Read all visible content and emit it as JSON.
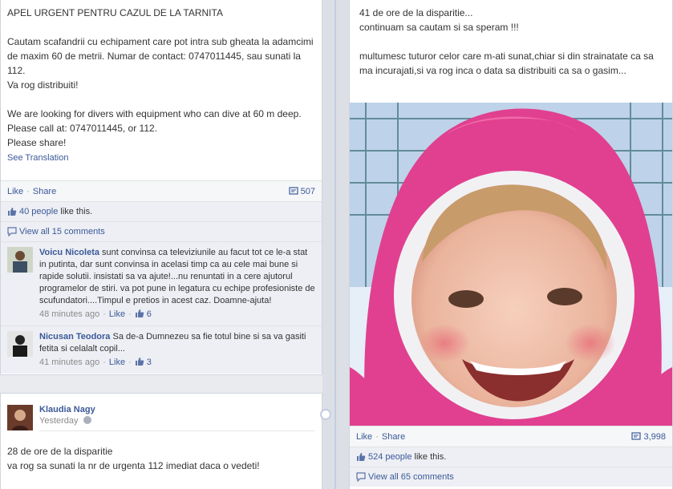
{
  "left_post": {
    "title": "APEL URGENT PENTRU CAZUL DE LA TARNITA",
    "body_ro": "Cautam scafandrii cu echipament care pot intra sub gheata la adamcimi de maxim 60 de metrii. Numar de contact: 0747011445, sau sunati la 112.\nVa rog distribuiti!",
    "body_en": "We are looking for divers with equipment who can dive at 60 m deep. Please call at: 0747011445, or 112.\nPlease share!",
    "see_translation": "See Translation",
    "like_label": "Like",
    "share_label": "Share",
    "share_count": "507",
    "likes_people": "40 people",
    "likes_suffix": "like this.",
    "view_comments": "View all 15 comments",
    "comments": [
      {
        "author": "Voicu Nicoleta",
        "text": "sunt convinsa ca televiziunile au facut tot ce le-a stat in putinta, dar sunt convinsa in acelasi timp ca au cele mai bune si rapide solutii. insistati sa va ajute!...nu renuntati in a cere ajutorul programelor de stiri. va pot pune in legatura cu echipe profesioniste de scufundatori....Timpul e pretios in acest caz. Doamne-ajuta!",
        "time": "48 minutes ago",
        "like": "Like",
        "likes": "6"
      },
      {
        "author": "Nicusan Teodora",
        "text": "Sa de-a Dumnezeu sa fie totul bine si sa va gasiti fetita si celalalt copil...",
        "time": "41 minutes ago",
        "like": "Like",
        "likes": "3"
      }
    ]
  },
  "bottom_post": {
    "author": "Klaudia Nagy",
    "time": "Yesterday",
    "body": "28 de ore de la disparitie\nva rog sa sunati la nr de urgenta 112 imediat daca o vedeti!"
  },
  "right_post": {
    "body": "41 de ore de la disparitie...\ncontinuam sa cautam si sa speram !!!\n\nmultumesc tuturor celor care m-ati sunat,chiar si din strainatate ca sa ma incurajati,si va rog inca o data sa distribuiti ca sa o gasim...",
    "like_label": "Like",
    "share_label": "Share",
    "share_count": "3,998",
    "likes_people": "524 people",
    "likes_suffix": "like this.",
    "view_comments": "View all 65 comments"
  },
  "colors": {
    "link": "#3b5998",
    "background": "#e9ebee",
    "coat_pink": "#e0408f"
  }
}
